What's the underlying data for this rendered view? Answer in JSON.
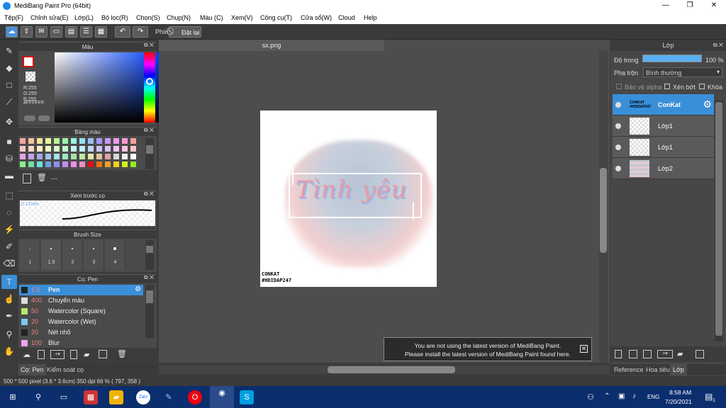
{
  "window": {
    "title": "MediBang Paint Pro (64bit)",
    "minimize": "—",
    "maximize": "❐",
    "close": "✕"
  },
  "menu": [
    "Tệp(F)",
    "Chỉnh sửa(E)",
    "Lớp(L)",
    "Bộ lọc(R)",
    "Chọn(S)",
    "Chụp(N)",
    "Màu (C)",
    "Xem(V)",
    "Công cụ(T)",
    "Cửa sổ(W)",
    "Cloud",
    "Help"
  ],
  "toolbar": {
    "phim_label": "Phím",
    "reset_label": "Đặt lại"
  },
  "color_panel": {
    "title": "Màu",
    "r": "R:255",
    "g": "G:255",
    "b": "B:255",
    "hex": "#FFFFFF"
  },
  "palette_panel": {
    "title": "Bảng màu",
    "footer": "---"
  },
  "preview_panel": {
    "title": "Xem trước cọ",
    "size": "0.11mm"
  },
  "brush_size_panel": {
    "title": "Brush Size",
    "sizes": [
      "1",
      "1.5",
      "2",
      "3",
      "4"
    ]
  },
  "brush_panel": {
    "title": "Cọ: Pen",
    "items": [
      {
        "size": "1.5",
        "name": "Pen",
        "color": "#222222"
      },
      {
        "size": "400",
        "name": "Chuyển màu",
        "color": "#dddddd"
      },
      {
        "size": "50",
        "name": "Watercolor (Square)",
        "color": "#b5e86a"
      },
      {
        "size": "20",
        "name": "Watercolor (Wet)",
        "color": "#7ec8f0"
      },
      {
        "size": "20",
        "name": "Nét nhỏ",
        "color": "#222222"
      },
      {
        "size": "100",
        "name": "Blur",
        "color": "#f0a0f0"
      }
    ]
  },
  "left_tabs": {
    "tab1": "Cọ: Pen",
    "tab2": "Kiểm soát cọ"
  },
  "canvas": {
    "tab": "sx.png",
    "artwork_text": "Tình yêu",
    "watermark1": "CONKAT",
    "watermark2": "#HDIDAP247"
  },
  "layer_panel": {
    "title": "Lớp",
    "opacity_label": "Độ trong",
    "opacity_value": "100 %",
    "blend_label": "Pha trộn",
    "blend_value": "Bình thường",
    "protect_alpha": "Bảo vệ alpha",
    "clip": "Xén bớt",
    "lock": "Khóa",
    "layers": [
      {
        "name": "ConKat",
        "thumb_text": "CONKAT #HDIDAP247"
      },
      {
        "name": "Lớp1"
      },
      {
        "name": "Lớp1"
      },
      {
        "name": "Lớp2"
      }
    ],
    "tabs": [
      "Reference",
      "Hoa tiêu",
      "Lớp"
    ]
  },
  "notice": {
    "line1": "You are not using the latest version of MediBang Paint.",
    "line2": "Please install the latest version of MediBang Paint found here."
  },
  "status": "500 * 500 pixel  (3.6 * 3.6cm)  350 dpi  66 %  ( 797, 358 )",
  "taskbar": {
    "zalo": "Zalo",
    "lang": "ENG",
    "time": "8:58 AM",
    "date": "7/20/2021",
    "notif": "1"
  }
}
